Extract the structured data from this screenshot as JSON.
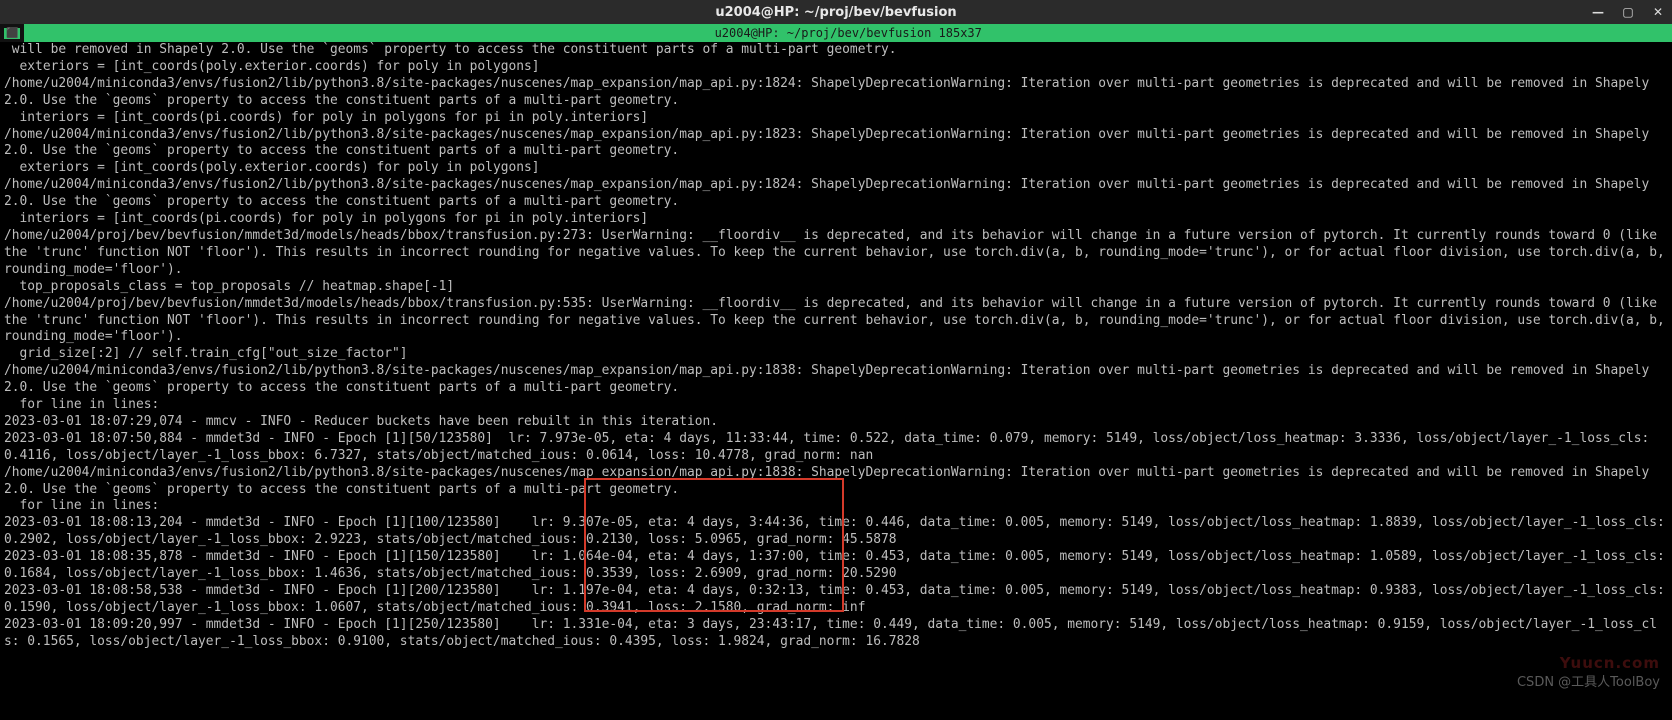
{
  "titlebar": {
    "title": "u2004@HP: ~/proj/bev/bevfusion"
  },
  "tmux": {
    "status": "u2004@HP: ~/proj/bev/bevfusion 185x37"
  },
  "watermark": {
    "site": "Yuucn.com",
    "text": "CSDN @工具人ToolBoy"
  },
  "terminal_lines": [
    " will be removed in Shapely 2.0. Use the `geoms` property to access the constituent parts of a multi-part geometry.",
    "  exteriors = [int_coords(poly.exterior.coords) for poly in polygons]",
    "/home/u2004/miniconda3/envs/fusion2/lib/python3.8/site-packages/nuscenes/map_expansion/map_api.py:1824: ShapelyDeprecationWarning: Iteration over multi-part geometries is deprecated and will be removed in Shapely 2.0. Use the `geoms` property to access the constituent parts of a multi-part geometry.",
    "  interiors = [int_coords(pi.coords) for poly in polygons for pi in poly.interiors]",
    "/home/u2004/miniconda3/envs/fusion2/lib/python3.8/site-packages/nuscenes/map_expansion/map_api.py:1823: ShapelyDeprecationWarning: Iteration over multi-part geometries is deprecated and will be removed in Shapely 2.0. Use the `geoms` property to access the constituent parts of a multi-part geometry.",
    "  exteriors = [int_coords(poly.exterior.coords) for poly in polygons]",
    "/home/u2004/miniconda3/envs/fusion2/lib/python3.8/site-packages/nuscenes/map_expansion/map_api.py:1824: ShapelyDeprecationWarning: Iteration over multi-part geometries is deprecated and will be removed in Shapely 2.0. Use the `geoms` property to access the constituent parts of a multi-part geometry.",
    "  interiors = [int_coords(pi.coords) for poly in polygons for pi in poly.interiors]",
    "/home/u2004/proj/bev/bevfusion/mmdet3d/models/heads/bbox/transfusion.py:273: UserWarning: __floordiv__ is deprecated, and its behavior will change in a future version of pytorch. It currently rounds toward 0 (like the 'trunc' function NOT 'floor'). This results in incorrect rounding for negative values. To keep the current behavior, use torch.div(a, b, rounding_mode='trunc'), or for actual floor division, use torch.div(a, b, rounding_mode='floor').",
    "  top_proposals_class = top_proposals // heatmap.shape[-1]",
    "/home/u2004/proj/bev/bevfusion/mmdet3d/models/heads/bbox/transfusion.py:535: UserWarning: __floordiv__ is deprecated, and its behavior will change in a future version of pytorch. It currently rounds toward 0 (like the 'trunc' function NOT 'floor'). This results in incorrect rounding for negative values. To keep the current behavior, use torch.div(a, b, rounding_mode='trunc'), or for actual floor division, use torch.div(a, b, rounding_mode='floor').",
    "  grid_size[:2] // self.train_cfg[\"out_size_factor\"]",
    "/home/u2004/miniconda3/envs/fusion2/lib/python3.8/site-packages/nuscenes/map_expansion/map_api.py:1838: ShapelyDeprecationWarning: Iteration over multi-part geometries is deprecated and will be removed in Shapely 2.0. Use the `geoms` property to access the constituent parts of a multi-part geometry.",
    "  for line in lines:",
    "2023-03-01 18:07:29,074 - mmcv - INFO - Reducer buckets have been rebuilt in this iteration.",
    "2023-03-01 18:07:50,884 - mmdet3d - INFO - Epoch [1][50/123580]  lr: 7.973e-05, eta: 4 days, 11:33:44, time: 0.522, data_time: 0.079, memory: 5149, loss/object/loss_heatmap: 3.3336, loss/object/layer_-1_loss_cls: 0.4116, loss/object/layer_-1_loss_bbox: 6.7327, stats/object/matched_ious: 0.0614, loss: 10.4778, grad_norm: nan",
    "/home/u2004/miniconda3/envs/fusion2/lib/python3.8/site-packages/nuscenes/map_expansion/map_api.py:1838: ShapelyDeprecationWarning: Iteration over multi-part geometries is deprecated and will be removed in Shapely 2.0. Use the `geoms` property to access the constituent parts of a multi-part geometry.",
    "  for line in lines:",
    "2023-03-01 18:08:13,204 - mmdet3d - INFO - Epoch [1][100/123580]    lr: 9.307e-05, eta: 4 days, 3:44:36, time: 0.446, data_time: 0.005, memory: 5149, loss/object/loss_heatmap: 1.8839, loss/object/layer_-1_loss_cls: 0.2902, loss/object/layer_-1_loss_bbox: 2.9223, stats/object/matched_ious: 0.2130, loss: 5.0965, grad_norm: 45.5878",
    "2023-03-01 18:08:35,878 - mmdet3d - INFO - Epoch [1][150/123580]    lr: 1.064e-04, eta: 4 days, 1:37:00, time: 0.453, data_time: 0.005, memory: 5149, loss/object/loss_heatmap: 1.0589, loss/object/layer_-1_loss_cls: 0.1684, loss/object/layer_-1_loss_bbox: 1.4636, stats/object/matched_ious: 0.3539, loss: 2.6909, grad_norm: 20.5290",
    "2023-03-01 18:08:58,538 - mmdet3d - INFO - Epoch [1][200/123580]    lr: 1.197e-04, eta: 4 days, 0:32:13, time: 0.453, data_time: 0.005, memory: 5149, loss/object/loss_heatmap: 0.9383, loss/object/layer_-1_loss_cls: 0.1590, loss/object/layer_-1_loss_bbox: 1.0607, stats/object/matched_ious: 0.3941, loss: 2.1580, grad_norm: inf",
    "2023-03-01 18:09:20,997 - mmdet3d - INFO - Epoch [1][250/123580]    lr: 1.331e-04, eta: 3 days, 23:43:17, time: 0.449, data_time: 0.005, memory: 5149, loss/object/loss_heatmap: 0.9159, loss/object/layer_-1_loss_cls: 0.1565, loss/object/layer_-1_loss_bbox: 0.9100, stats/object/matched_ious: 0.4395, loss: 1.9824, grad_norm: 16.7828"
  ]
}
